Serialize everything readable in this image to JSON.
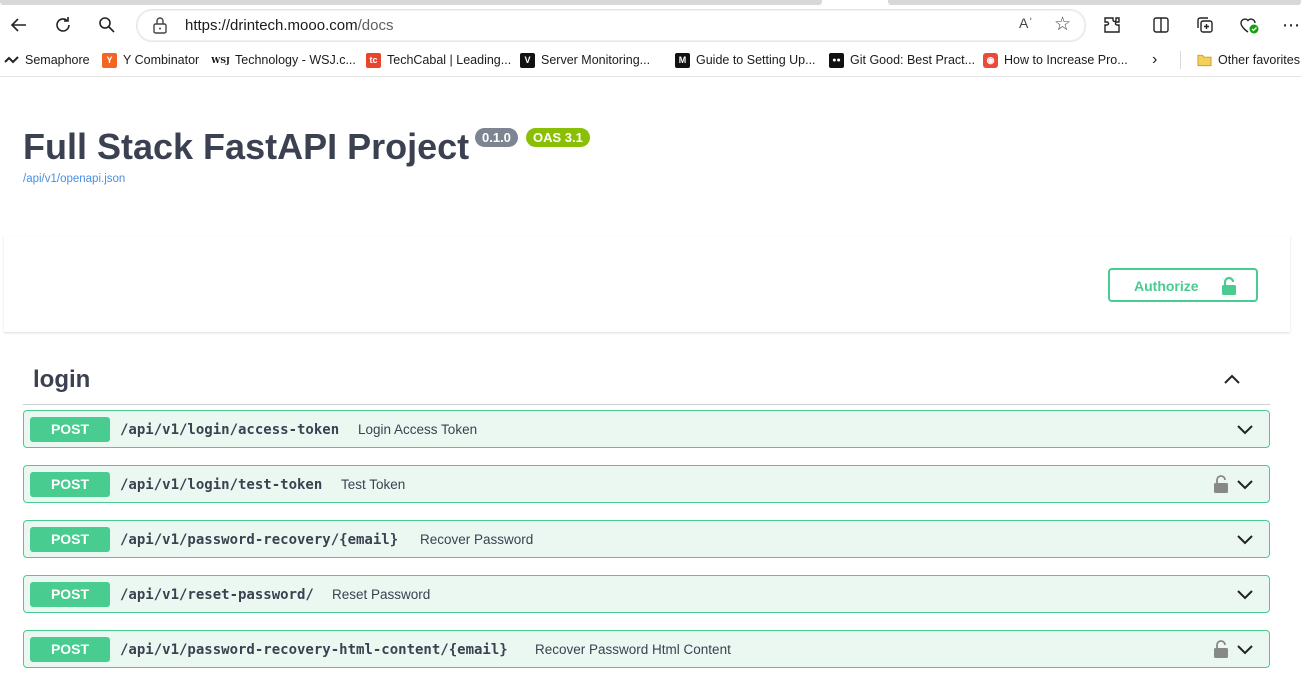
{
  "browser": {
    "url_host": "https://drintech.mooo.com",
    "url_path": "/docs",
    "read_aloud": "Aʾ",
    "bookmarks": [
      {
        "label": "Semaphore",
        "icon": "semaphore-icon"
      },
      {
        "label": "Y Combinator",
        "icon": "ycombinator-icon"
      },
      {
        "label": "Technology - WSJ.c...",
        "icon": "wsj-icon"
      },
      {
        "label": "TechCabal | Leading...",
        "icon": "techcabal-icon"
      },
      {
        "label": "Server Monitoring...",
        "icon": "v-icon"
      },
      {
        "label": "Guide to Setting Up...",
        "icon": "medium-icon"
      },
      {
        "label": "Git Good: Best Pract...",
        "icon": "medium-dots-icon"
      },
      {
        "label": "How to Increase Pro...",
        "icon": "eye-icon"
      }
    ],
    "other_favorites": "Other favorites"
  },
  "info": {
    "title": "Full Stack FastAPI Project",
    "version": "0.1.0",
    "oas": "OAS 3.1",
    "spec_url": "/api/v1/openapi.json"
  },
  "authorize": {
    "label": "Authorize"
  },
  "tag": {
    "name": "login"
  },
  "operations": [
    {
      "method": "POST",
      "path": "/api/v1/login/access-token",
      "summary": "Login Access Token",
      "locked": false
    },
    {
      "method": "POST",
      "path": "/api/v1/login/test-token",
      "summary": "Test Token",
      "locked": true
    },
    {
      "method": "POST",
      "path": "/api/v1/password-recovery/{email}",
      "summary": "Recover Password",
      "locked": false
    },
    {
      "method": "POST",
      "path": "/api/v1/reset-password/",
      "summary": "Reset Password",
      "locked": false
    },
    {
      "method": "POST",
      "path": "/api/v1/password-recovery-html-content/{email}",
      "summary": "Recover Password Html Content",
      "locked": true
    }
  ],
  "colors": {
    "post": "#49cc90",
    "post_bg": "#ebf8f2",
    "link": "#4990e2",
    "version_badge": "#7d8492",
    "oas_badge": "#89bf04"
  }
}
